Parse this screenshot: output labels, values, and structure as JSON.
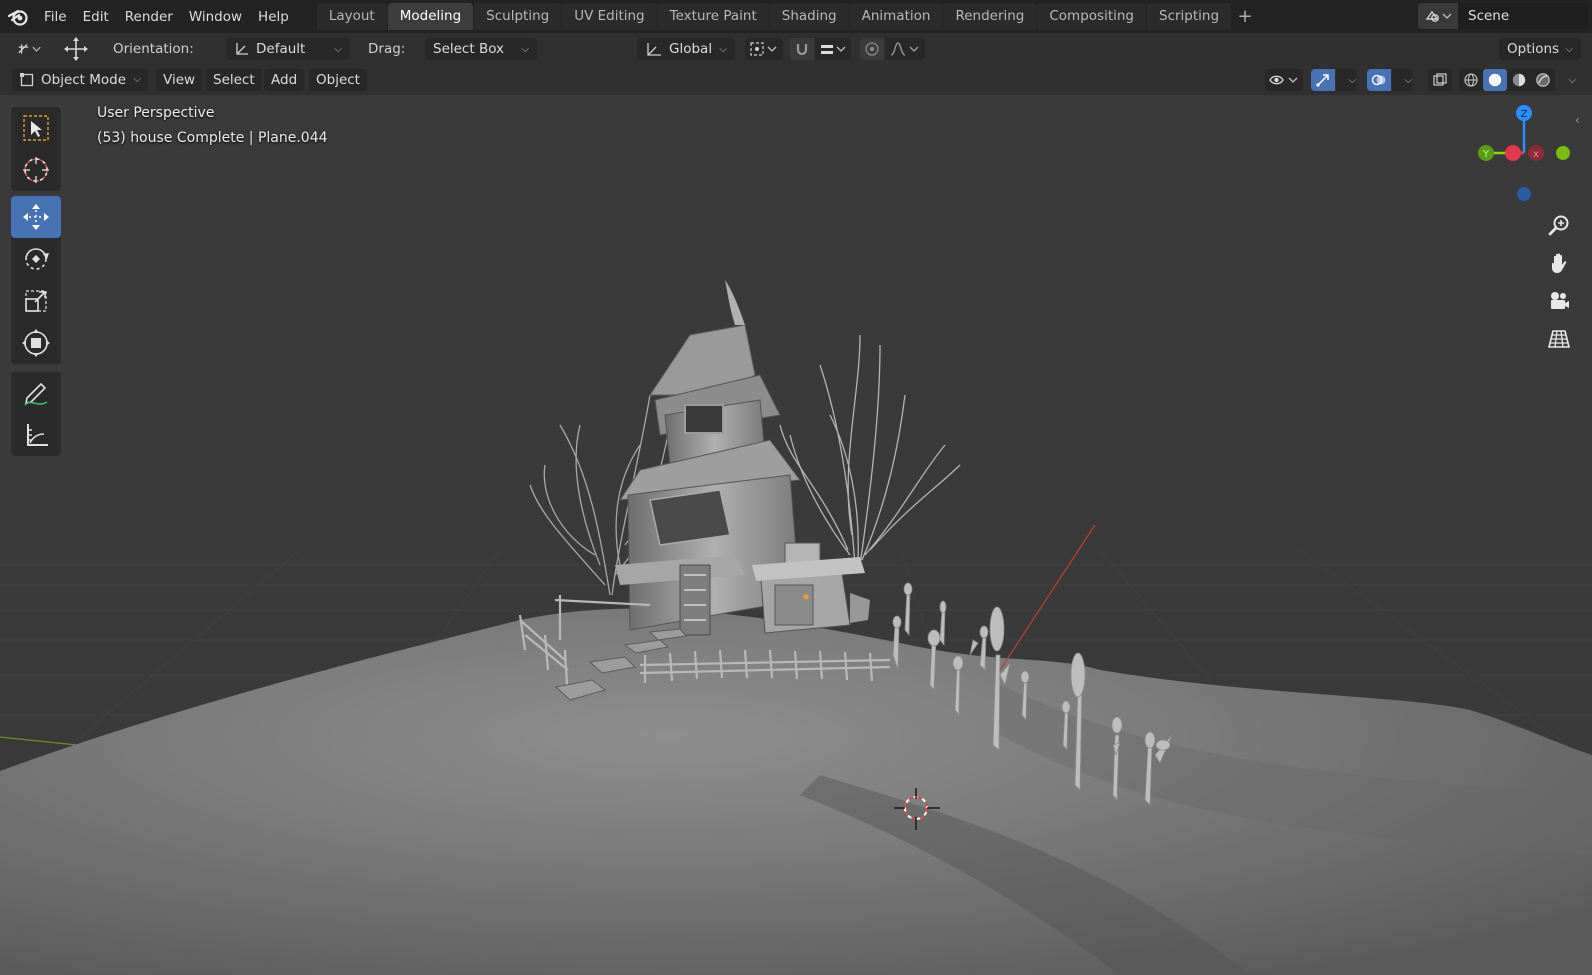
{
  "menubar": {
    "items": [
      "File",
      "Edit",
      "Render",
      "Window",
      "Help"
    ]
  },
  "workspaces": {
    "tabs": [
      "Layout",
      "Modeling",
      "Sculpting",
      "UV Editing",
      "Texture Paint",
      "Shading",
      "Animation",
      "Rendering",
      "Compositing",
      "Scripting"
    ],
    "active": "Modeling",
    "add_label": "+"
  },
  "scene": {
    "name": "Scene"
  },
  "tool_settings": {
    "orientation_label": "Orientation:",
    "orientation_value": "Default",
    "drag_label": "Drag:",
    "drag_value": "Select Box",
    "transform_orientation": "Global",
    "options_label": "Options"
  },
  "header": {
    "mode": "Object Mode",
    "menus": [
      "View",
      "Select",
      "Add",
      "Object"
    ]
  },
  "viewport": {
    "perspective_label": "User Perspective",
    "object_info": "(53) house Complete | Plane.044"
  },
  "gizmo": {
    "z": "Z",
    "y": "Y",
    "x": "X"
  },
  "colors": {
    "accent": "#4772b3",
    "axis_x": "#e5374c",
    "axis_y": "#8bdc00",
    "axis_z": "#2c8fff",
    "topbar": "#232323",
    "panel": "#303030"
  }
}
